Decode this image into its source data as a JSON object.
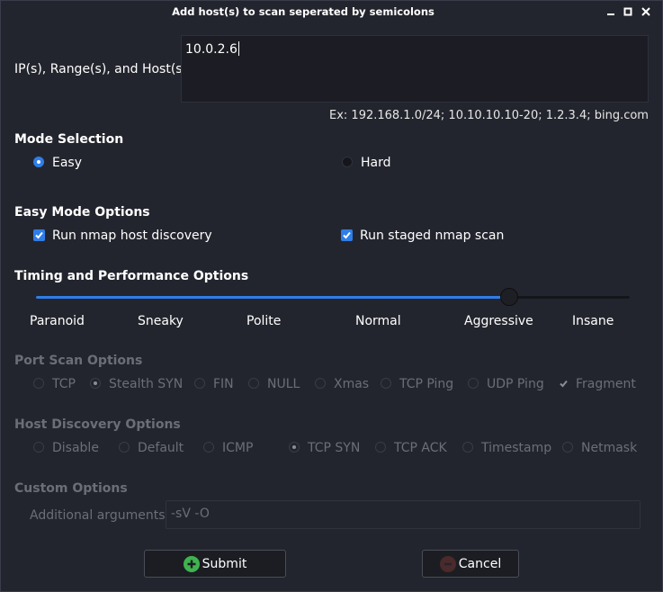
{
  "window": {
    "title": "Add host(s) to scan seperated by semicolons",
    "controls": [
      "minimize-icon",
      "maximize-icon",
      "close-icon"
    ]
  },
  "hosts": {
    "label": "IP(s), Range(s), and Host(s)",
    "value": "10.0.2.6",
    "example": "Ex: 192.168.1.0/24; 10.10.10.10-20; 1.2.3.4; bing.com"
  },
  "mode": {
    "heading": "Mode Selection",
    "options": [
      {
        "label": "Easy",
        "selected": true
      },
      {
        "label": "Hard",
        "selected": false
      }
    ]
  },
  "easy_options": {
    "heading": "Easy Mode Options",
    "items": [
      {
        "label": "Run nmap host discovery",
        "checked": true
      },
      {
        "label": "Run staged nmap scan",
        "checked": true
      }
    ]
  },
  "timing": {
    "heading": "Timing and Performance Options",
    "levels": [
      "Paranoid",
      "Sneaky",
      "Polite",
      "Normal",
      "Aggressive",
      "Insane"
    ],
    "selected_index": 4,
    "accent": "#2f7ee8"
  },
  "port_scan": {
    "heading": "Port Scan Options",
    "options": [
      {
        "label": "TCP",
        "selected": false
      },
      {
        "label": "Stealth SYN",
        "selected": true
      },
      {
        "label": "FIN",
        "selected": false
      },
      {
        "label": "NULL",
        "selected": false
      },
      {
        "label": "Xmas",
        "selected": false
      },
      {
        "label": "TCP Ping",
        "selected": false
      },
      {
        "label": "UDP Ping",
        "selected": false
      }
    ],
    "fragment": {
      "label": "Fragment",
      "checked": true
    }
  },
  "host_discovery": {
    "heading": "Host Discovery Options",
    "options": [
      {
        "label": "Disable",
        "selected": false
      },
      {
        "label": "Default",
        "selected": false
      },
      {
        "label": "ICMP",
        "selected": false
      },
      {
        "label": "TCP SYN",
        "selected": true
      },
      {
        "label": "TCP ACK",
        "selected": false
      },
      {
        "label": "Timestamp",
        "selected": false
      },
      {
        "label": "Netmask",
        "selected": false
      }
    ]
  },
  "custom": {
    "heading": "Custom Options",
    "label": "Additional arguments",
    "value": "-sV -O"
  },
  "buttons": {
    "submit": "Submit",
    "cancel": "Cancel",
    "submit_color": "#3fb34f",
    "cancel_color": "#c0392b"
  }
}
